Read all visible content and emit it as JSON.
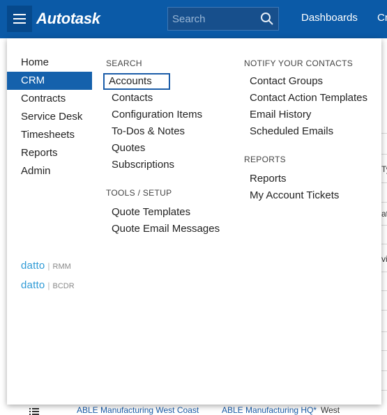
{
  "topbar": {
    "logo_text": "Autotask",
    "search_placeholder": "Search",
    "nav": [
      "Dashboards",
      "Cr"
    ]
  },
  "leftnav": {
    "items": [
      {
        "label": "Home",
        "active": false
      },
      {
        "label": "CRM",
        "active": true
      },
      {
        "label": "Contracts",
        "active": false
      },
      {
        "label": "Service Desk",
        "active": false
      },
      {
        "label": "Timesheets",
        "active": false
      },
      {
        "label": "Reports",
        "active": false
      },
      {
        "label": "Admin",
        "active": false
      }
    ]
  },
  "partners": [
    {
      "name": "datto",
      "product": "RMM"
    },
    {
      "name": "datto",
      "product": "BCDR"
    }
  ],
  "search_section": {
    "heading": "SEARCH",
    "items": [
      "Accounts",
      "Contacts",
      "Configuration Items",
      "To-Dos & Notes",
      "Quotes",
      "Subscriptions"
    ]
  },
  "tools_section": {
    "heading": "TOOLS / SETUP",
    "items": [
      "Quote Templates",
      "Quote Email Messages"
    ]
  },
  "notify_section": {
    "heading": "NOTIFY YOUR CONTACTS",
    "items": [
      "Contact Groups",
      "Contact Action Templates",
      "Email History",
      "Scheduled Emails"
    ]
  },
  "reports_section": {
    "heading": "REPORTS",
    "items": [
      "Reports",
      "My Account Tickets"
    ]
  },
  "background": {
    "fragments": [
      "Ty",
      "at",
      "vi"
    ],
    "bottom_link_1": "ABLE Manufacturing West Coast",
    "bottom_link_2": "ABLE Manufacturing HQ*",
    "bottom_text": "West"
  },
  "colors": {
    "topbar": "#0b5aa7",
    "active_nav": "#1561ac",
    "focus_border": "#1a5ca8",
    "datto": "#2e9ad6"
  }
}
